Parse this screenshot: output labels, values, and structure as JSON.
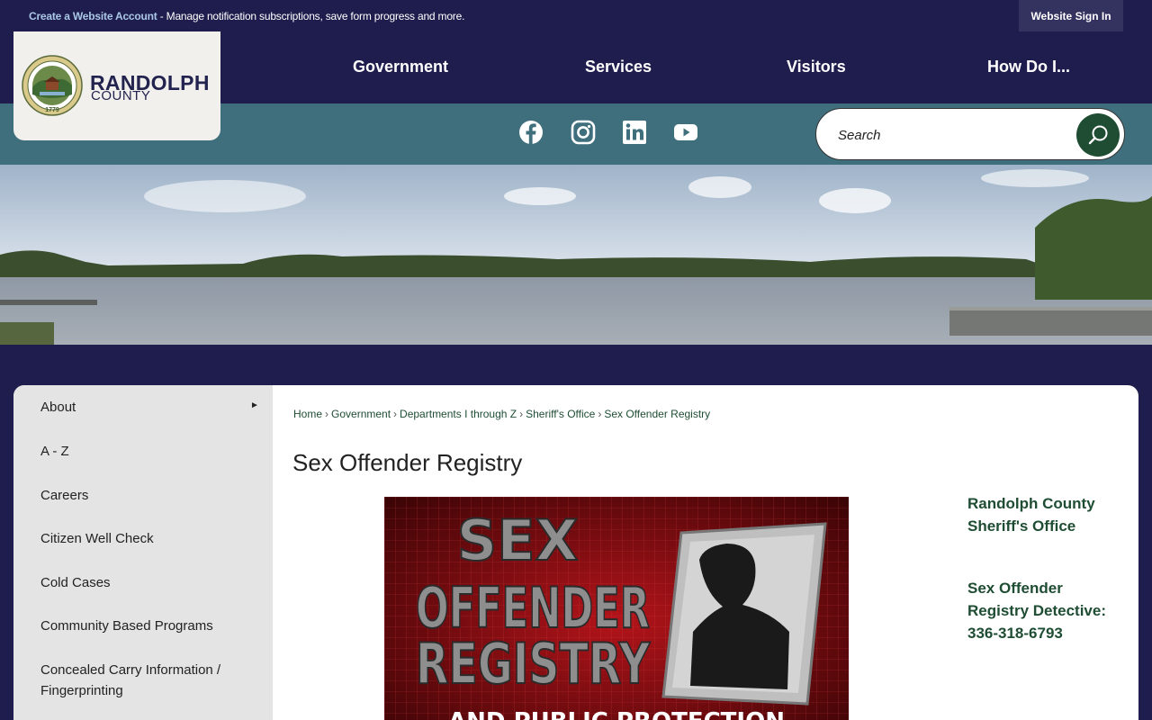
{
  "topbar": {
    "create_link": "Create a Website Account",
    "create_message": " - Manage notification subscriptions, save form progress and more.",
    "sign_in": "Website Sign In"
  },
  "logo": {
    "name": "RANDOLPH",
    "sub": "COUNTY"
  },
  "nav": {
    "items": [
      "Government",
      "Services",
      "Visitors",
      "How Do I..."
    ]
  },
  "social": {
    "icons": [
      "facebook-icon",
      "instagram-icon",
      "linkedin-icon",
      "youtube-icon"
    ]
  },
  "search": {
    "placeholder": "Search"
  },
  "sidebar": {
    "items": [
      "About",
      "A - Z",
      "Careers",
      "Citizen Well Check",
      "Cold Cases",
      "Community Based Programs",
      "Concealed Carry Information / Fingerprinting"
    ]
  },
  "breadcrumb": {
    "items": [
      "Home",
      "Government",
      "Departments I through Z",
      "Sheriff's Office",
      "Sex Offender Registry"
    ]
  },
  "page": {
    "title": "Sex Offender Registry"
  },
  "poster": {
    "line1": "SEX",
    "line2": "OFFENDER",
    "line3": "REGISTRY",
    "line4": "AND PUBLIC PROTECTION"
  },
  "contact": {
    "office": "Randolph County Sheriff's Office",
    "detective": "Sex Offender Registry Detective: 336-318-6793"
  },
  "colors": {
    "navy": "#1f1d4d",
    "teal": "#3f6f7d",
    "green": "#1f4d33",
    "sidebar_bg": "#e4e4e4"
  }
}
